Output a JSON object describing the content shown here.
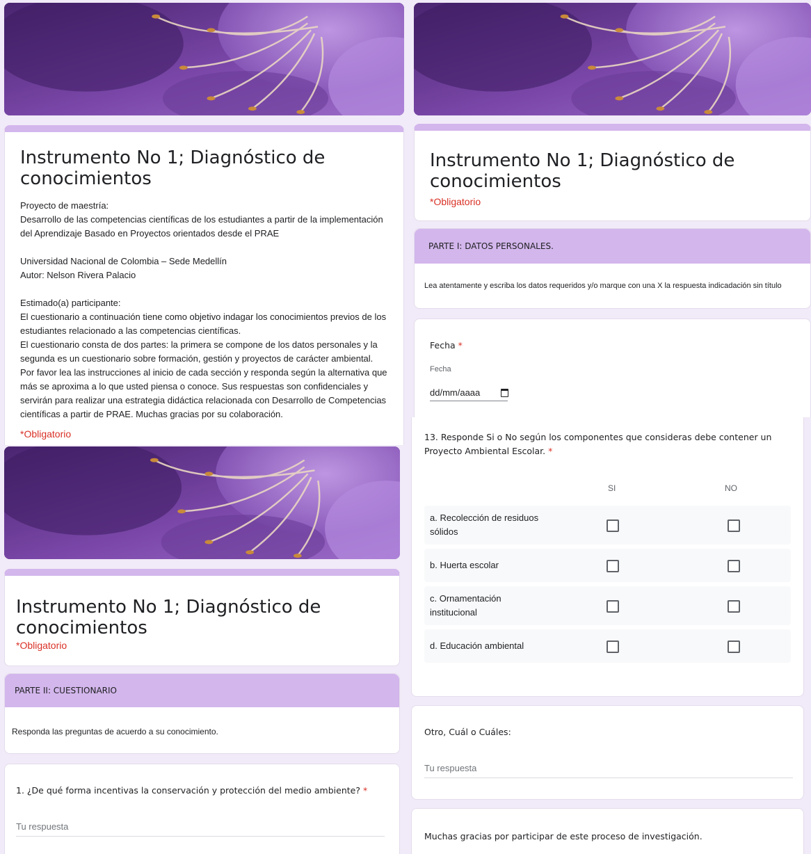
{
  "form": {
    "title": "Instrumento No 1; Diagnóstico de conocimientos",
    "required_note": "*Obligatorio"
  },
  "intro": {
    "description": "Proyecto de maestría:\nDesarrollo de las competencias científicas de los estudiantes a partir de la implementación del Aprendizaje Basado en Proyectos orientados desde el PRAE\n\nUniversidad Nacional de Colombia – Sede Medellín\nAutor: Nelson Rivera Palacio\n\nEstimado(a) participante:\nEl cuestionario a continuación tiene como objetivo indagar los conocimientos previos de los estudiantes relacionado a las competencias científicas.\nEl cuestionario consta de dos partes: la primera se compone de los datos personales y la segunda es un cuestionario sobre formación, gestión y proyectos de carácter ambiental. Por favor lea las instrucciones al inicio de cada sección y responda según la alternativa que más se aproxima a lo que usted piensa o conoce. Sus respuestas son confidenciales y servirán para realizar una estrategia didáctica relacionada con Desarrollo de Competencias científicas a partir de PRAE. Muchas gracias por su colaboración."
  },
  "part1": {
    "section_title": "PARTE I: DATOS PERSONALES.",
    "section_description": "Lea atentamente y escriba los datos requeridos y/o marque con una X la respuesta indicadación sin título",
    "date_label": "Fecha",
    "date_required": "*",
    "date_sublabel": "Fecha",
    "date_placeholder": "dd/mm/aaaa"
  },
  "part2": {
    "section_title": "PARTE II: CUESTIONARIO",
    "section_description": "Responda las preguntas de acuerdo a su conocimiento.",
    "q1_label": "1. ¿De qué forma incentivas la conservación y protección del medio ambiente?",
    "q1_required": "*",
    "answer_placeholder": "Tu respuesta"
  },
  "q13": {
    "label": "13. Responde Si o No según los componentes que consideras debe contener un Proyecto Ambiental Escolar.",
    "required": "*",
    "columns": [
      "SI",
      "NO"
    ],
    "rows": [
      "a. Recolección de residuos sólidos",
      "b. Huerta escolar",
      "c. Ornamentación institucional",
      "d. Educación ambiental"
    ]
  },
  "other": {
    "label": "Otro, Cuál o Cuáles:",
    "placeholder": "Tu respuesta"
  },
  "closing": {
    "text": "Muchas gracias por participar de este proceso de investigación."
  },
  "colors": {
    "accent": "#d3b6ec",
    "background": "#f1eaf8",
    "required": "#d93025"
  },
  "icons": {
    "date_picker": "calendar-icon",
    "checkbox": "checkbox-icon"
  }
}
